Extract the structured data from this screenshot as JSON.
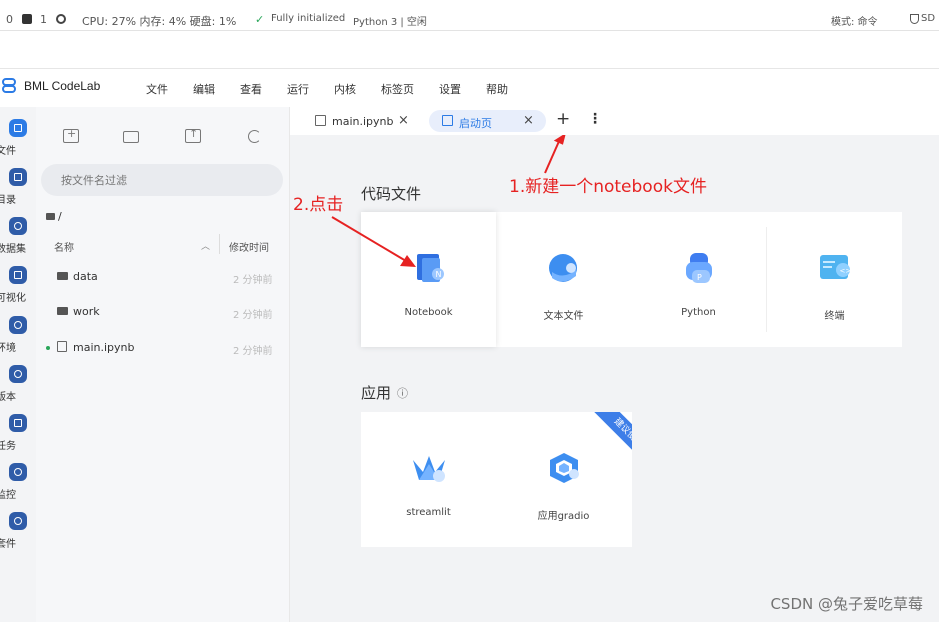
{
  "statusbar": {
    "zero": "0",
    "one": "1",
    "cpu": "CPU: 27% 内存: 4% 硬盘: 1%",
    "init": "Fully initialized",
    "kernel": "Python 3 | 空闲",
    "mode": "模式: 命令",
    "sd": "SD"
  },
  "app": {
    "title": "BML CodeLab",
    "menu": [
      "文件",
      "编辑",
      "查看",
      "运行",
      "内核",
      "标签页",
      "设置",
      "帮助"
    ]
  },
  "rail": [
    {
      "label": "文件",
      "icon": "folder-icon"
    },
    {
      "label": "目录",
      "icon": "toc-icon"
    },
    {
      "label": "数据集",
      "icon": "dataset-icon"
    },
    {
      "label": "可视化",
      "icon": "chart-icon"
    },
    {
      "label": "环境",
      "icon": "environment-icon"
    },
    {
      "label": "版本",
      "icon": "version-icon"
    },
    {
      "label": "任务",
      "icon": "task-icon"
    },
    {
      "label": "监控",
      "icon": "monitor-icon"
    },
    {
      "label": "套件",
      "icon": "suite-icon"
    }
  ],
  "filepanel": {
    "filter_placeholder": "按文件名过滤",
    "breadcrumb": "/",
    "col_name": "名称",
    "col_time": "修改时间",
    "files": [
      {
        "name": "data",
        "time": "2 分钟前"
      },
      {
        "name": "work",
        "time": "2 分钟前"
      },
      {
        "name": "main.ipynb",
        "time": "2 分钟前"
      }
    ]
  },
  "tabs": [
    {
      "label": "main.ipynb",
      "close": "×"
    },
    {
      "label": "启动页",
      "close": "×"
    }
  ],
  "tab_add": "+",
  "tab_more": "⋮",
  "launcher": {
    "code_section": "代码文件",
    "code_items": [
      "Notebook",
      "文本文件",
      "Python",
      "终端"
    ],
    "app_section": "应用",
    "app_info": "ⓘ",
    "app_items": [
      "streamlit",
      "应用gradio"
    ],
    "ribbon": "建议使用"
  },
  "annotations": {
    "step1": "1.新建一个notebook文件",
    "step2": "2.点击",
    "color": "#e62222"
  },
  "watermark": "CSDN @兔子爱吃草莓",
  "colors": {
    "accent": "#2c7be5",
    "rail_bg": "#f3f4f6",
    "main_bg": "#f2f3f5"
  }
}
